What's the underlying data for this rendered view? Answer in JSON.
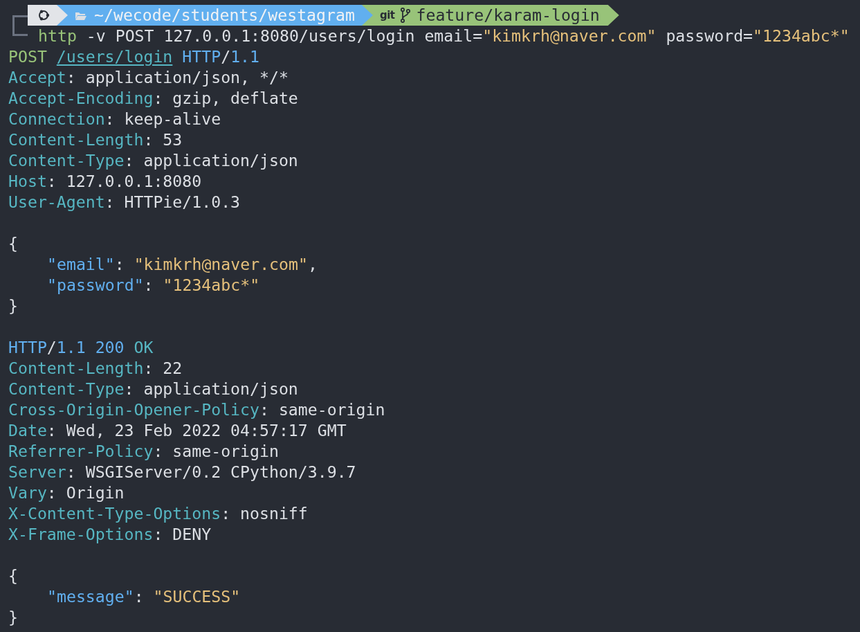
{
  "prompt": {
    "segments": [
      {
        "kind": "os"
      },
      {
        "kind": "path",
        "text": "~/wecode/students/westagram"
      },
      {
        "kind": "git",
        "label": "git",
        "text": "feature/karam-login"
      }
    ]
  },
  "command": [
    {
      "kind": "command",
      "text": "http"
    },
    {
      "kind": "plain",
      "text": " -v POST 127.0.0.1:8080/users/login email="
    },
    {
      "kind": "string",
      "text": "\"kimkrh@naver.com\""
    },
    {
      "kind": "plain",
      "text": " password="
    },
    {
      "kind": "string",
      "text": "\"1234abc*\""
    }
  ],
  "output": [
    {
      "kind": "line",
      "tokens": [
        {
          "kind": "method",
          "text": "POST "
        },
        {
          "kind": "url",
          "text": "/users/login"
        },
        {
          "kind": "protocol",
          "text": " HTTP"
        },
        {
          "kind": "plain",
          "text": "/"
        },
        {
          "kind": "protocol",
          "text": "1.1"
        }
      ]
    },
    {
      "kind": "line",
      "tokens": [
        {
          "kind": "header",
          "text": "Accept"
        },
        {
          "kind": "plain",
          "text": ": application/json, */*"
        }
      ]
    },
    {
      "kind": "line",
      "tokens": [
        {
          "kind": "header",
          "text": "Accept-Encoding"
        },
        {
          "kind": "plain",
          "text": ": gzip, deflate"
        }
      ]
    },
    {
      "kind": "line",
      "tokens": [
        {
          "kind": "header",
          "text": "Connection"
        },
        {
          "kind": "plain",
          "text": ": keep-alive"
        }
      ]
    },
    {
      "kind": "line",
      "tokens": [
        {
          "kind": "header",
          "text": "Content-Length"
        },
        {
          "kind": "plain",
          "text": ": 53"
        }
      ]
    },
    {
      "kind": "line",
      "tokens": [
        {
          "kind": "header",
          "text": "Content-Type"
        },
        {
          "kind": "plain",
          "text": ": application/json"
        }
      ]
    },
    {
      "kind": "line",
      "tokens": [
        {
          "kind": "header",
          "text": "Host"
        },
        {
          "kind": "plain",
          "text": ": 127.0.0.1:8080"
        }
      ]
    },
    {
      "kind": "line",
      "tokens": [
        {
          "kind": "header",
          "text": "User-Agent"
        },
        {
          "kind": "plain",
          "text": ": HTTPie/1.0.3"
        }
      ]
    },
    {
      "kind": "blank"
    },
    {
      "kind": "line",
      "tokens": [
        {
          "kind": "plain",
          "text": "{"
        }
      ]
    },
    {
      "kind": "indented",
      "tokens": [
        {
          "kind": "key",
          "text": "\"email\""
        },
        {
          "kind": "plain",
          "text": ": "
        },
        {
          "kind": "string",
          "text": "\"kimkrh@naver.com\""
        },
        {
          "kind": "plain",
          "text": ","
        }
      ]
    },
    {
      "kind": "indented",
      "tokens": [
        {
          "kind": "key",
          "text": "\"password\""
        },
        {
          "kind": "plain",
          "text": ": "
        },
        {
          "kind": "string",
          "text": "\"1234abc*\""
        }
      ]
    },
    {
      "kind": "line",
      "tokens": [
        {
          "kind": "plain",
          "text": "}"
        }
      ]
    },
    {
      "kind": "blank"
    },
    {
      "kind": "line",
      "tokens": [
        {
          "kind": "protocol",
          "text": "HTTP"
        },
        {
          "kind": "plain",
          "text": "/"
        },
        {
          "kind": "protocol",
          "text": "1.1 200 "
        },
        {
          "kind": "reason",
          "text": "OK"
        }
      ]
    },
    {
      "kind": "line",
      "tokens": [
        {
          "kind": "header",
          "text": "Content-Length"
        },
        {
          "kind": "plain",
          "text": ": 22"
        }
      ]
    },
    {
      "kind": "line",
      "tokens": [
        {
          "kind": "header",
          "text": "Content-Type"
        },
        {
          "kind": "plain",
          "text": ": application/json"
        }
      ]
    },
    {
      "kind": "line",
      "tokens": [
        {
          "kind": "header",
          "text": "Cross-Origin-Opener-Policy"
        },
        {
          "kind": "plain",
          "text": ": same-origin"
        }
      ]
    },
    {
      "kind": "line",
      "tokens": [
        {
          "kind": "header",
          "text": "Date"
        },
        {
          "kind": "plain",
          "text": ": Wed, 23 Feb 2022 04:57:17 GMT"
        }
      ]
    },
    {
      "kind": "line",
      "tokens": [
        {
          "kind": "header",
          "text": "Referrer-Policy"
        },
        {
          "kind": "plain",
          "text": ": same-origin"
        }
      ]
    },
    {
      "kind": "line",
      "tokens": [
        {
          "kind": "header",
          "text": "Server"
        },
        {
          "kind": "plain",
          "text": ": WSGIServer/0.2 CPython/3.9.7"
        }
      ]
    },
    {
      "kind": "line",
      "tokens": [
        {
          "kind": "header",
          "text": "Vary"
        },
        {
          "kind": "plain",
          "text": ": Origin"
        }
      ]
    },
    {
      "kind": "line",
      "tokens": [
        {
          "kind": "header",
          "text": "X-Content-Type-Options"
        },
        {
          "kind": "plain",
          "text": ": nosniff"
        }
      ]
    },
    {
      "kind": "line",
      "tokens": [
        {
          "kind": "header",
          "text": "X-Frame-Options"
        },
        {
          "kind": "plain",
          "text": ": DENY"
        }
      ]
    },
    {
      "kind": "blank"
    },
    {
      "kind": "line",
      "tokens": [
        {
          "kind": "plain",
          "text": "{"
        }
      ]
    },
    {
      "kind": "indented",
      "tokens": [
        {
          "kind": "key",
          "text": "\"message\""
        },
        {
          "kind": "plain",
          "text": ": "
        },
        {
          "kind": "string",
          "text": "\"SUCCESS\""
        }
      ]
    },
    {
      "kind": "line",
      "tokens": [
        {
          "kind": "plain",
          "text": "}"
        }
      ]
    }
  ]
}
